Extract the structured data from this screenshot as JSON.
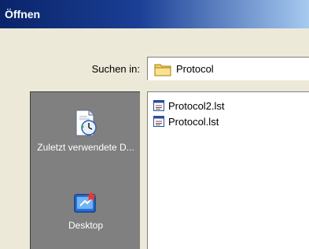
{
  "window": {
    "title": "Öffnen"
  },
  "look_in": {
    "label": "Suchen in:",
    "value": "Protocol",
    "icon": "folder-icon"
  },
  "places": [
    {
      "label": "Zuletzt verwendete D...",
      "icon": "recent-documents-icon"
    },
    {
      "label": "Desktop",
      "icon": "desktop-icon"
    }
  ],
  "files": [
    {
      "name": "Protocol2.lst",
      "icon": "lst-file-icon"
    },
    {
      "name": "Protocol.lst",
      "icon": "lst-file-icon"
    }
  ],
  "colors": {
    "titlebar_start": "#0a246a",
    "titlebar_end": "#a6caf0",
    "dialog_bg": "#ece9d8",
    "places_bg": "#808080"
  }
}
